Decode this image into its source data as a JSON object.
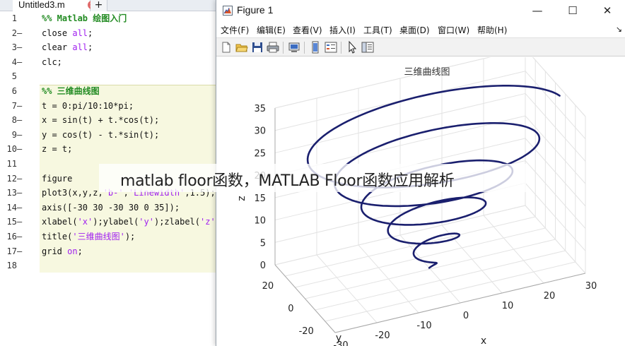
{
  "editor": {
    "tab_label": "Untitled3.m",
    "add_tab_label": "+",
    "lines": [
      {
        "num": "1",
        "dash": "",
        "segments": [
          {
            "t": "%% Matlab 绘图入门",
            "c": "comment"
          }
        ]
      },
      {
        "num": "2",
        "dash": "—",
        "segments": [
          {
            "t": "close ",
            "c": ""
          },
          {
            "t": "all",
            "c": "str"
          },
          {
            "t": ";",
            "c": ""
          }
        ]
      },
      {
        "num": "3",
        "dash": "—",
        "segments": [
          {
            "t": "clear ",
            "c": ""
          },
          {
            "t": "all",
            "c": "str"
          },
          {
            "t": ";",
            "c": ""
          }
        ]
      },
      {
        "num": "4",
        "dash": "—",
        "segments": [
          {
            "t": "clc;",
            "c": ""
          }
        ]
      },
      {
        "num": "5",
        "dash": "",
        "segments": []
      },
      {
        "num": "6",
        "dash": "",
        "segments": [
          {
            "t": "%% 三维曲线图",
            "c": "comment"
          }
        ]
      },
      {
        "num": "7",
        "dash": "—",
        "segments": [
          {
            "t": "t = 0:pi/10:10*pi;",
            "c": ""
          }
        ]
      },
      {
        "num": "8",
        "dash": "—",
        "segments": [
          {
            "t": "x = sin(t) + t.*cos(t);",
            "c": ""
          }
        ]
      },
      {
        "num": "9",
        "dash": "—",
        "segments": [
          {
            "t": "y = cos(t) - t.*sin(t);",
            "c": ""
          }
        ]
      },
      {
        "num": "10",
        "dash": "—",
        "segments": [
          {
            "t": "z = t;",
            "c": ""
          }
        ]
      },
      {
        "num": "11",
        "dash": "",
        "segments": []
      },
      {
        "num": "12",
        "dash": "—",
        "segments": [
          {
            "t": "figure",
            "c": ""
          }
        ]
      },
      {
        "num": "13",
        "dash": "—",
        "segments": [
          {
            "t": "plot3(x,y,z,",
            "c": ""
          },
          {
            "t": "'b-'",
            "c": "str"
          },
          {
            "t": ",",
            "c": ""
          },
          {
            "t": "'Linewidth'",
            "c": "str"
          },
          {
            "t": ",1.5);",
            "c": ""
          }
        ]
      },
      {
        "num": "14",
        "dash": "—",
        "segments": [
          {
            "t": "axis([-30 30 -30 30 0 35]);",
            "c": ""
          }
        ]
      },
      {
        "num": "15",
        "dash": "—",
        "segments": [
          {
            "t": "xlabel(",
            "c": ""
          },
          {
            "t": "'x'",
            "c": "str"
          },
          {
            "t": ");ylabel(",
            "c": ""
          },
          {
            "t": "'y'",
            "c": "str"
          },
          {
            "t": ");zlabel(",
            "c": ""
          },
          {
            "t": "'z'",
            "c": "str"
          },
          {
            "t": ");",
            "c": ""
          }
        ]
      },
      {
        "num": "16",
        "dash": "—",
        "segments": [
          {
            "t": "title(",
            "c": ""
          },
          {
            "t": "'三维曲线图'",
            "c": "str"
          },
          {
            "t": ");",
            "c": ""
          }
        ]
      },
      {
        "num": "17",
        "dash": "—",
        "segments": [
          {
            "t": "grid ",
            "c": ""
          },
          {
            "t": "on",
            "c": "str"
          },
          {
            "t": ";",
            "c": ""
          }
        ]
      },
      {
        "num": "18",
        "dash": "",
        "segments": []
      }
    ]
  },
  "figure": {
    "title": "Figure 1",
    "window_controls": {
      "minimize": "—",
      "maximize": "☐",
      "close": "✕"
    },
    "menu": [
      "文件(F)",
      "编辑(E)",
      "查看(V)",
      "插入(I)",
      "工具(T)",
      "桌面(D)",
      "窗口(W)",
      "帮助(H)"
    ],
    "menu_overflow": "↘",
    "toolbar_icons": [
      "new-file-icon",
      "open-folder-icon",
      "save-icon",
      "print-icon",
      "print-preview-icon",
      "link-plot-icon",
      "insert-legend-icon",
      "pointer-icon",
      "property-editor-icon"
    ],
    "plot_title": "三维曲线图",
    "line_color": "#1a1f6e"
  },
  "chart_data": {
    "type": "line",
    "title": "三维曲线图",
    "xlabel": "x",
    "ylabel": "y",
    "zlabel": "z",
    "xlim": [
      -30,
      30
    ],
    "ylim": [
      -30,
      30
    ],
    "zlim": [
      0,
      35
    ],
    "x_ticks": [
      "-30",
      "-20",
      "-10",
      "0",
      "10",
      "20",
      "30"
    ],
    "y_ticks": [
      "-20",
      "0",
      "20"
    ],
    "z_ticks": [
      "0",
      "5",
      "10",
      "15",
      "20",
      "25",
      "30",
      "35"
    ],
    "grid": true,
    "series": [
      {
        "equation_x": "sin(t) + t.*cos(t)",
        "equation_y": "cos(t) - t.*sin(t)",
        "equation_z": "t",
        "t_range": [
          0,
          31.4159
        ],
        "t_step": 0.314159,
        "line_width": 1.5
      }
    ]
  },
  "overlay": {
    "caption": "matlab floor函数，MATLAB Floor函数应用解析"
  }
}
